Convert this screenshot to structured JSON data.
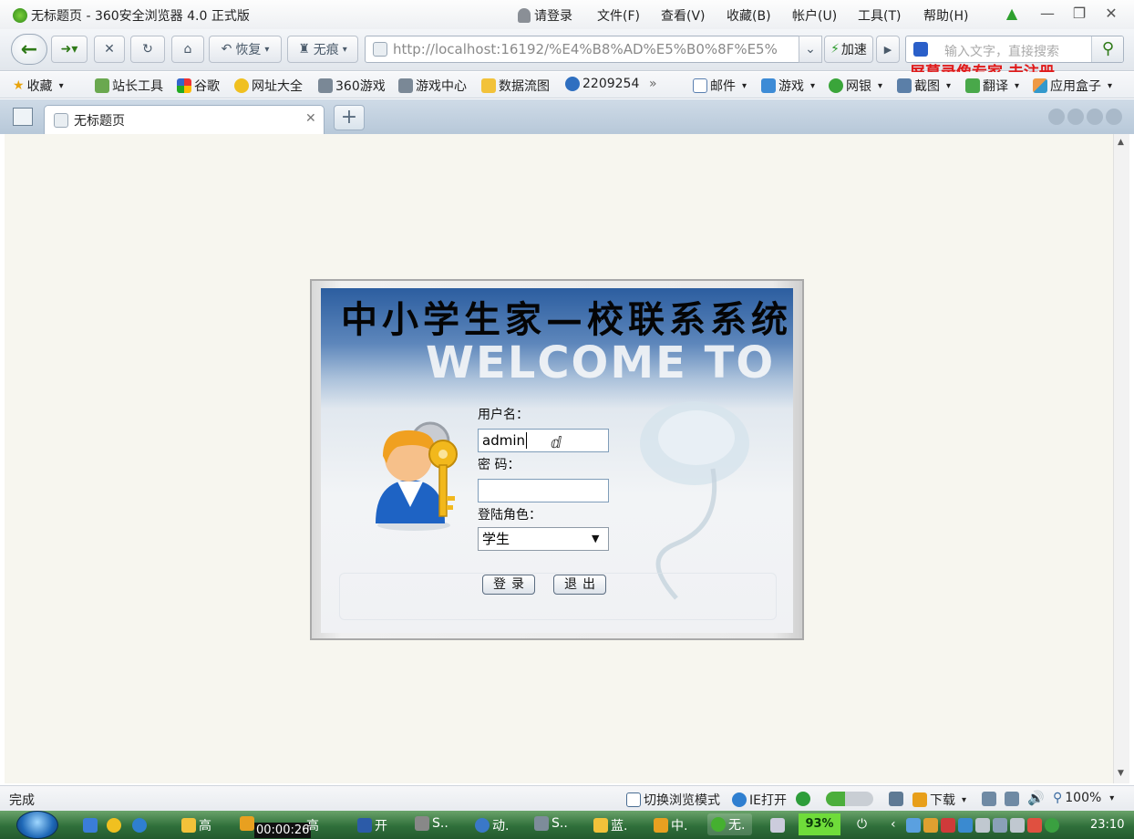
{
  "window": {
    "title": "无标题页 - 360安全浏览器 4.0 正式版",
    "login_label": "请登录",
    "menu": [
      "文件(F)",
      "查看(V)",
      "收藏(B)",
      "帐户(U)",
      "工具(T)",
      "帮助(H)"
    ]
  },
  "toolbar": {
    "restore_label": "恢复",
    "incognito_label": "无痕",
    "address": "http://localhost:16192/%E4%B8%AD%E5%B0%8F%E5%",
    "speed_label": "加速",
    "search_placeholder": "输入文字，直接搜索",
    "watermark": "屏幕录像专家  未注册"
  },
  "favorites": {
    "fav_label": "收藏",
    "items": [
      "站长工具",
      "谷歌",
      "网址大全",
      "360游戏",
      "游戏中心",
      "数据流图",
      "2209254"
    ],
    "more": "»",
    "right_items": [
      "邮件",
      "游戏",
      "网银",
      "截图",
      "翻译",
      "应用盒子"
    ]
  },
  "tabs": {
    "active_title": "无标题页",
    "new_tab": "+"
  },
  "login": {
    "system_name": "中小学生家—校联系系统",
    "welcome": "WELCOME TO",
    "username_label": "用户名：",
    "username_value": "admin",
    "password_label": "密 码：",
    "password_value": "",
    "role_label": "登陆角色：",
    "role_value": "学生",
    "login_button": "登录",
    "exit_button": "退出"
  },
  "statusbar": {
    "status": "完成",
    "switch_mode": "切换浏览模式",
    "ie_open": "IE打开",
    "download": "下载",
    "zoom": "100%"
  },
  "taskbar": {
    "items": [
      "高",
      "高",
      "开",
      "S..",
      "动.",
      "S..",
      "蓝.",
      "中.",
      "无."
    ],
    "recording_time": "00:00:26",
    "battery": "93%",
    "clock": "23:10"
  },
  "colors": {
    "accent_green": "#2f7a18",
    "watermark_red": "#e01a1a",
    "taskbar_green": "#2f6f3a"
  }
}
